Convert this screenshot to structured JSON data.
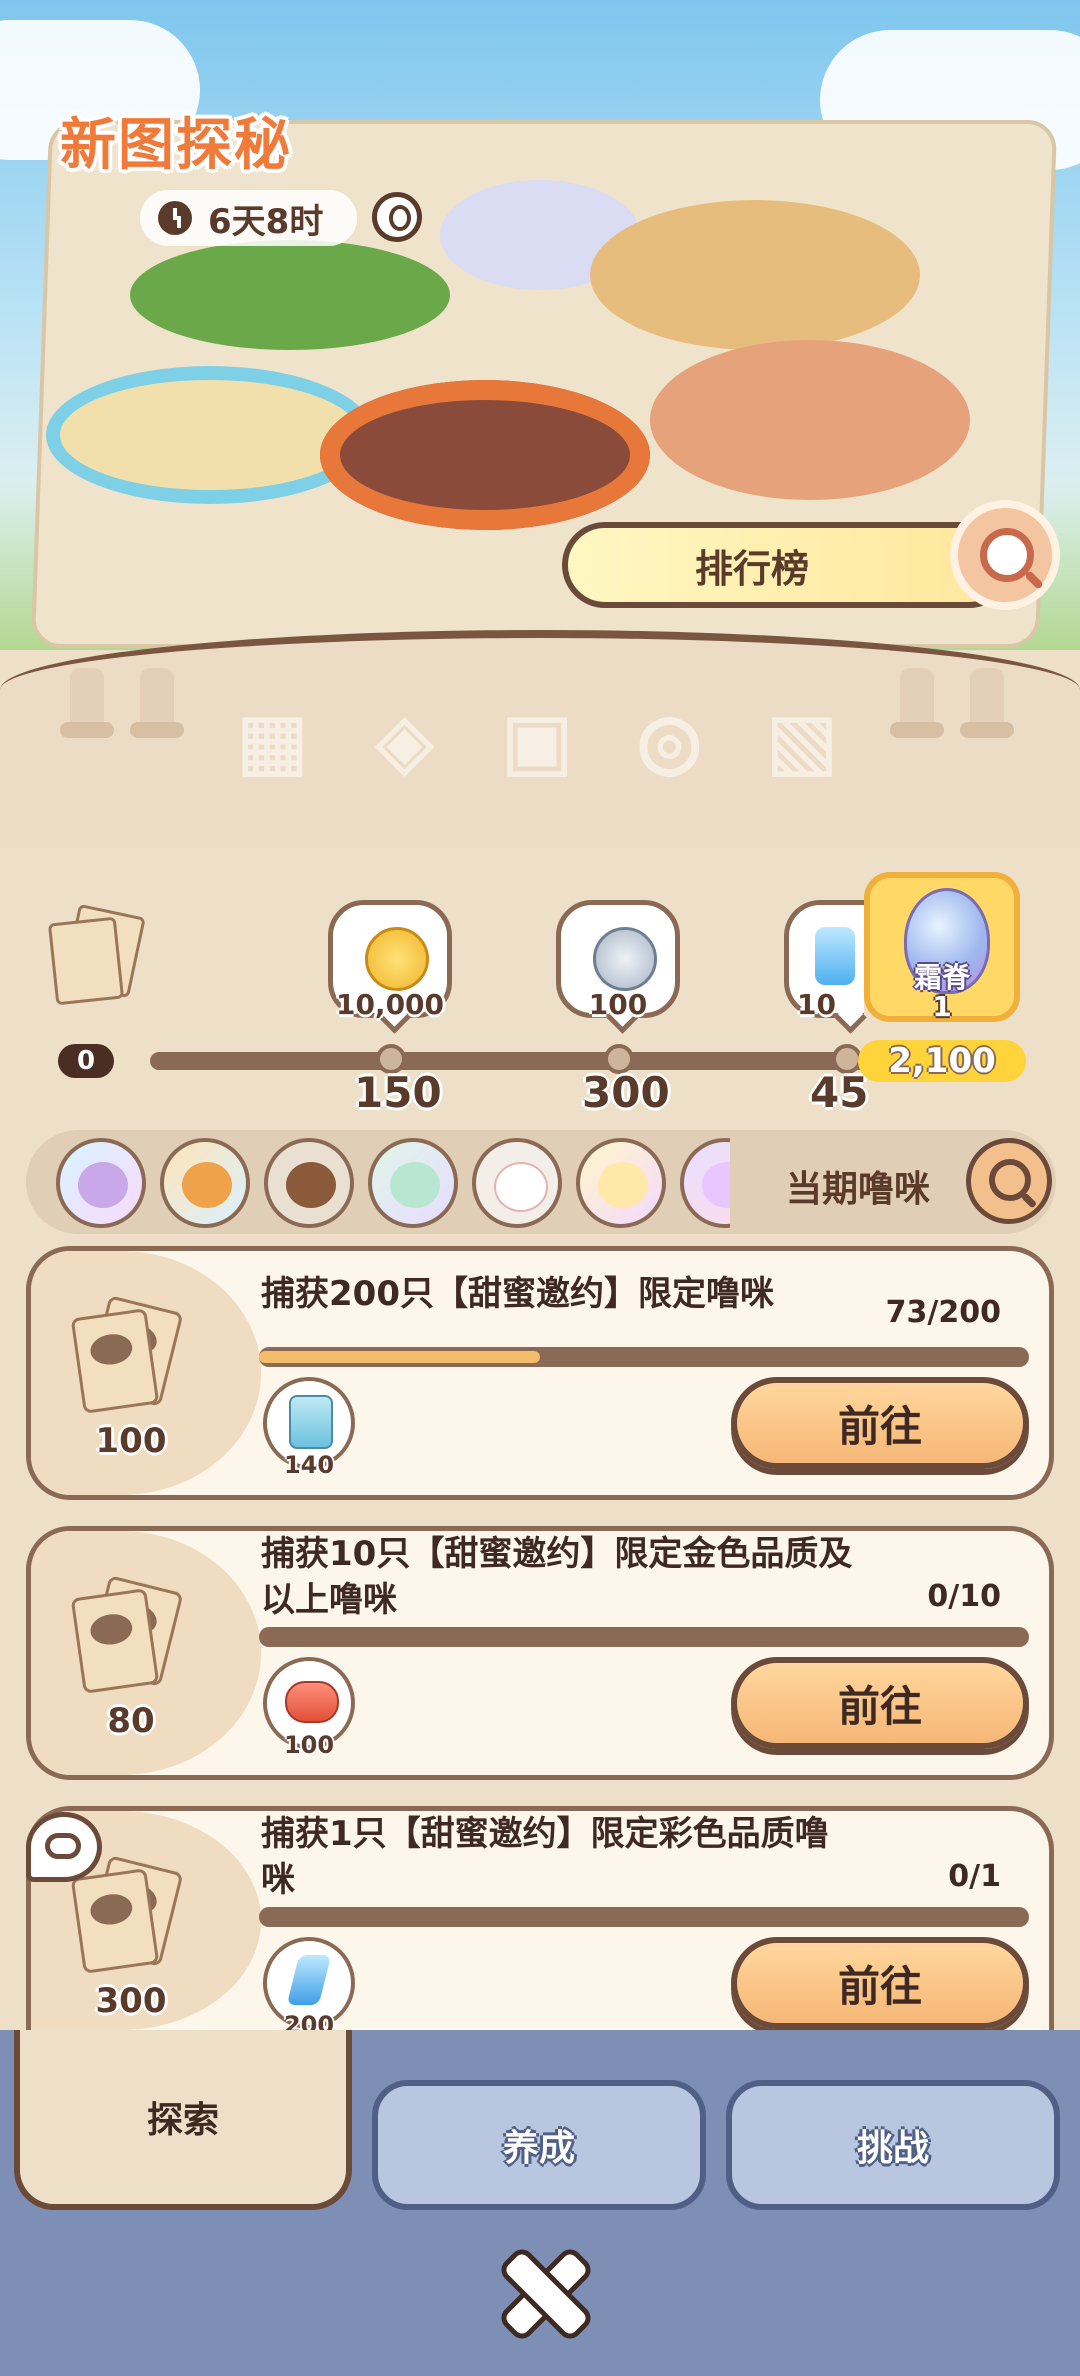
{
  "header": {
    "title": "新图探秘",
    "timer": "6天8时",
    "ranking_label": "排行榜"
  },
  "milestones": {
    "start": "0",
    "labels": [
      "150",
      "300",
      "45"
    ],
    "rewards": [
      {
        "amount": "10,000",
        "icon": "gold-coin-icon"
      },
      {
        "amount": "100",
        "icon": "silver-coin-icon"
      },
      {
        "amount": "10",
        "icon": "crystal-icon"
      }
    ],
    "final": {
      "name": "霜脊",
      "count": "1",
      "score": "2,100"
    }
  },
  "pets": {
    "label": "当期噜咪",
    "count": 7
  },
  "tasks": [
    {
      "qty": "100",
      "title": "捕获200只【甜蜜邀约】限定噜咪",
      "count": "73/200",
      "progress": 0.365,
      "reward_amt": "140",
      "reward_icon": "card-icon",
      "button": "前往"
    },
    {
      "qty": "80",
      "title": "捕获10只【甜蜜邀约】限定金色品质及以上噜咪",
      "count": "0/10",
      "progress": 0,
      "reward_amt": "100",
      "reward_icon": "candy-icon",
      "button": "前往"
    },
    {
      "qty": "300",
      "title": "捕获1只【甜蜜邀约】限定彩色品质噜咪",
      "count": "0/1",
      "progress": 0,
      "reward_amt": "200",
      "reward_icon": "lightning-icon",
      "button": "前往"
    }
  ],
  "nav": {
    "tabs": [
      "探索",
      "养成",
      "挑战"
    ]
  },
  "colors": {
    "accent": "#f07a3a",
    "brown": "#6b4a3a",
    "nav_bg": "#7d8fb4",
    "progress_fill": "#f3bd6b"
  }
}
